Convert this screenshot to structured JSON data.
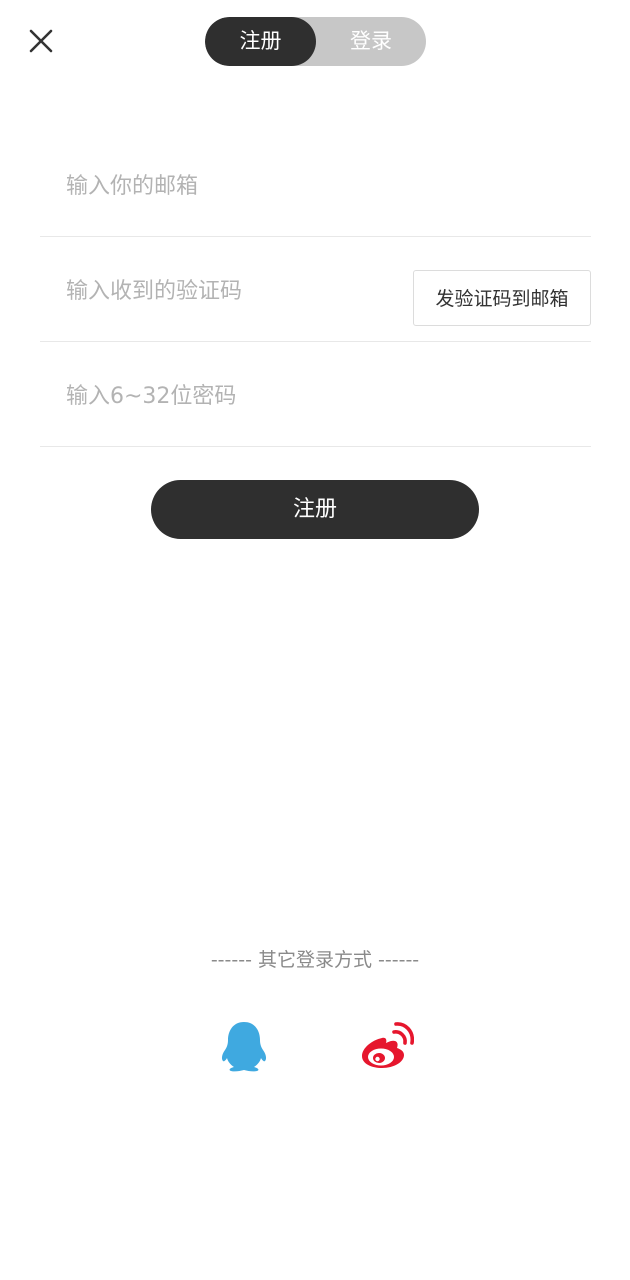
{
  "header": {
    "close_icon": "close-icon",
    "tabs": [
      {
        "label": "注册",
        "active": true
      },
      {
        "label": "登录",
        "active": false
      }
    ]
  },
  "form": {
    "email": {
      "placeholder": "输入你的邮箱",
      "value": ""
    },
    "code": {
      "placeholder": "输入收到的验证码",
      "value": ""
    },
    "send_code_label": "发验证码到邮箱",
    "password": {
      "placeholder": "输入6~32位密码",
      "value": ""
    },
    "submit_label": "注册"
  },
  "other_login": {
    "title": "------ 其它登录方式 ------",
    "providers": [
      {
        "icon": "qq-icon",
        "color": "#3fa9e0"
      },
      {
        "icon": "weibo-icon",
        "color": "#e6162d"
      }
    ]
  },
  "colors": {
    "dark": "#2f2f2f",
    "inactive_tab": "#c7c7c7",
    "divider": "#e8e8e8"
  }
}
